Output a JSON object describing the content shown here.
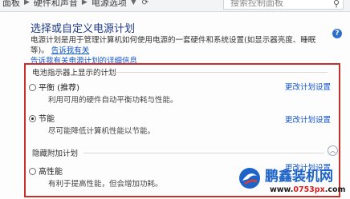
{
  "breadcrumb": {
    "items": [
      "硬件和声音",
      "电源选项"
    ],
    "prefix": "面板"
  },
  "search": {
    "placeholder": "搜索控制面板"
  },
  "page": {
    "title": "选择或自定义电源计划",
    "description": "电源计划是用于管理计算机如何使用电源的一套硬件和系统设置(如显示器亮度、睡眠等)。",
    "link_tail": "告诉我有关电源计划的详细信息",
    "link_head": "告诉我有关"
  },
  "sections": {
    "battery_header": "电池指示器上显示的计划",
    "hidden_header": "隐藏附加计划"
  },
  "plans": [
    {
      "name": "平衡 (推荐)",
      "desc": "利用可用的硬件自动平衡功耗与性能。",
      "link": "更改计划设置",
      "selected": false
    },
    {
      "name": "节能",
      "desc": "尽可能降低计算机性能以节能。",
      "link": "更改计划设置",
      "selected": true
    },
    {
      "name": "高性能",
      "desc": "有利于提高性能，但会增加功耗。",
      "link": "更改计划设置",
      "selected": false
    }
  ],
  "watermark": {
    "brand": "鹏鑫装机网",
    "url_prefix": "www.",
    "url_mid": "0753px",
    "url_suffix": ".com"
  },
  "colors": {
    "accent": "#1e3a8a",
    "link": "#1155cc",
    "highlight_frame": "#c9302c"
  }
}
